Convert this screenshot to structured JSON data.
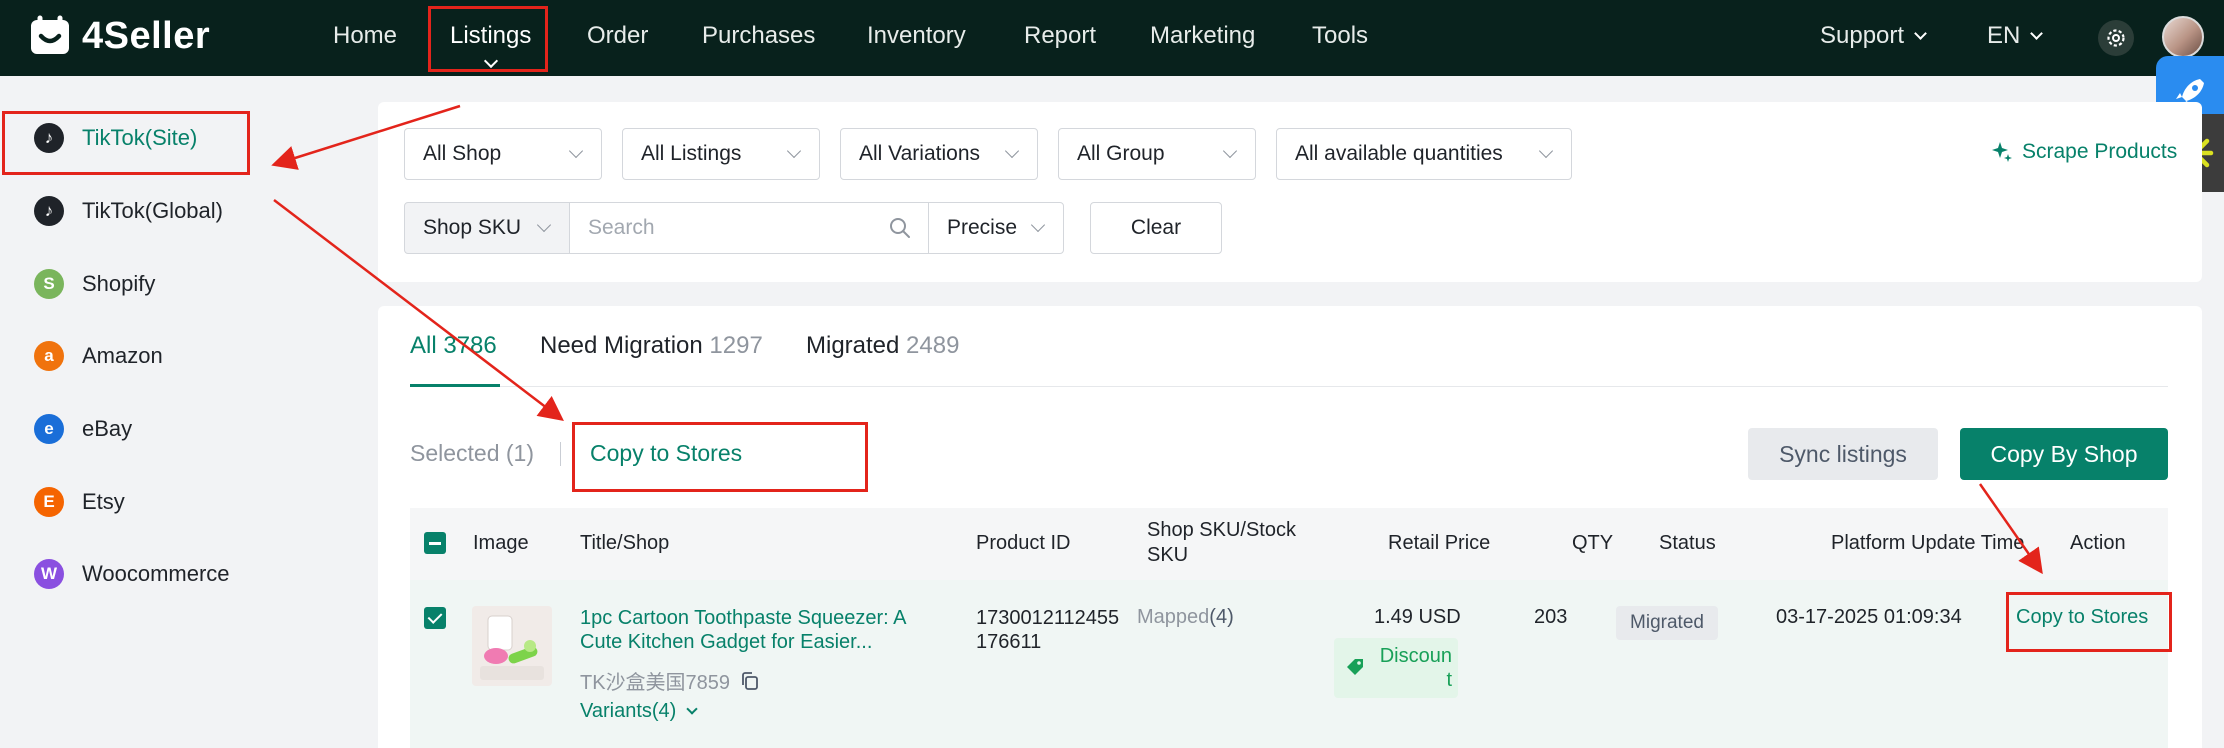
{
  "header": {
    "logo_text": "4Seller",
    "nav": [
      {
        "label": "Home"
      },
      {
        "label": "Listings"
      },
      {
        "label": "Order"
      },
      {
        "label": "Purchases"
      },
      {
        "label": "Inventory"
      },
      {
        "label": "Report"
      },
      {
        "label": "Marketing"
      },
      {
        "label": "Tools"
      }
    ],
    "support_label": "Support",
    "lang_label": "EN"
  },
  "sidebar": {
    "items": [
      {
        "label": "TikTok(Site)",
        "icon": "tiktok-icon",
        "active": true
      },
      {
        "label": "TikTok(Global)",
        "icon": "tiktok-icon"
      },
      {
        "label": "Shopify",
        "icon": "shopify-icon"
      },
      {
        "label": "Amazon",
        "icon": "amazon-icon"
      },
      {
        "label": "eBay",
        "icon": "ebay-icon"
      },
      {
        "label": "Etsy",
        "icon": "etsy-icon"
      },
      {
        "label": "Woocommerce",
        "icon": "woocommerce-icon"
      }
    ]
  },
  "filters": {
    "shop": "All Shop",
    "listings": "All Listings",
    "variations": "All Variations",
    "group": "All Group",
    "quantities": "All available quantities",
    "scrape_label": "Scrape Products",
    "search_field": "Shop SKU",
    "search_placeholder": "Search",
    "match_mode": "Precise",
    "clear_label": "Clear"
  },
  "tabs": [
    {
      "label": "All",
      "count": "3786"
    },
    {
      "label": "Need Migration",
      "count": "1297"
    },
    {
      "label": "Migrated",
      "count": "2489"
    }
  ],
  "toolbar": {
    "selected_label": "Selected (1)",
    "copy_to_stores_label": "Copy to Stores",
    "sync_label": "Sync listings",
    "copy_by_shop_label": "Copy By Shop"
  },
  "table": {
    "columns": {
      "image": "Image",
      "title": "Title/Shop",
      "product_id": "Product ID",
      "sku": "Shop SKU/Stock SKU",
      "price": "Retail Price",
      "qty": "QTY",
      "status": "Status",
      "updated": "Platform Update Time",
      "action": "Action"
    },
    "rows": [
      {
        "title": "1pc Cartoon Toothpaste Squeezer: A Cute Kitchen Gadget for Easier...",
        "shop": "TK沙盒美国7859",
        "variants": "Variants(4)",
        "product_id": "1730012112455176611",
        "mapped_label": "Mapped",
        "mapped_count": "(4)",
        "price": "1.49 USD",
        "discount": "Discount",
        "qty": "203",
        "status": "Migrated",
        "updated": "03-17-2025 01:09:34",
        "action": "Copy to Stores"
      }
    ]
  },
  "colors": {
    "brand": "#07816a",
    "header_bg": "#08211c",
    "annotation": "#e3241b"
  }
}
